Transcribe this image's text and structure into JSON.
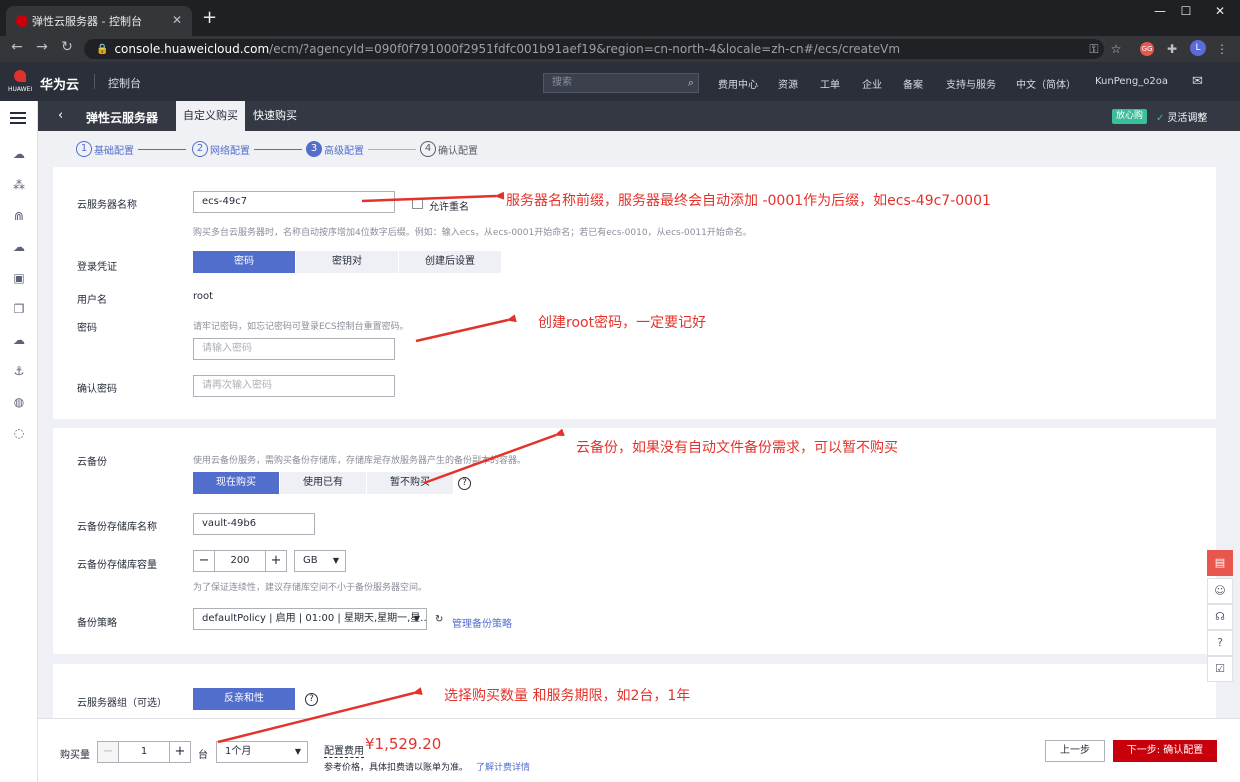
{
  "browser": {
    "tab_title": "弹性云服务器 - 控制台",
    "url_host": "console.huaweicloud.com",
    "url_path": "/ecm/?agencyId=090f0f791000f2951fdfc001b91aef19&region=cn-north-4&locale=zh-cn#/ecs/createVm",
    "profile_initial": "L",
    "ext_badge": "GG"
  },
  "topnav": {
    "brand": "华为云",
    "logo_word": "HUAWEI",
    "console": "控制台",
    "search_placeholder": "搜索",
    "items": [
      "费用中心",
      "资源",
      "工单",
      "企业",
      "备案",
      "支持与服务",
      "中文（简体）",
      "KunPeng_o2oa"
    ]
  },
  "header": {
    "title": "弹性云服务器",
    "tabs": [
      "自定义购买",
      "快速购买"
    ],
    "peace_badge": "放心购",
    "flex_adjust": "灵活调整"
  },
  "steps": [
    {
      "num": "1",
      "label": "基础配置"
    },
    {
      "num": "2",
      "label": "网络配置"
    },
    {
      "num": "3",
      "label": "高级配置"
    },
    {
      "num": "4",
      "label": "确认配置"
    }
  ],
  "name_section": {
    "label": "云服务器名称",
    "value": "ecs-49c7",
    "allow_dup": "允许重名",
    "hint": "购买多台云服务器时，名称自动按序增加4位数字后缀。例如：输入ecs，从ecs-0001开始命名；若已有ecs-0010，从ecs-0011开始命名。",
    "login_label": "登录凭证",
    "login_options": [
      "密码",
      "密钥对",
      "创建后设置"
    ],
    "username_label": "用户名",
    "username_value": "root",
    "password_label": "密码",
    "password_hint": "请牢记密码，如忘记密码可登录ECS控制台重置密码。",
    "password_placeholder": "请输入密码",
    "confirm_label": "确认密码",
    "confirm_placeholder": "请再次输入密码"
  },
  "backup_section": {
    "label": "云备份",
    "desc": "使用云备份服务，需购买备份存储库，存储库是存放服务器产生的备份副本的容器。",
    "options": [
      "现在购买",
      "使用已有",
      "暂不购买"
    ],
    "vault_label": "云备份存储库名称",
    "vault_value": "vault-49b6",
    "capacity_label": "云备份存储库容量",
    "capacity_value": "200",
    "capacity_unit": "GB",
    "capacity_hint": "为了保证连续性，建议存储库空间不小于备份服务器空间。",
    "policy_label": "备份策略",
    "policy_value": "defaultPolicy | 启用 | 01:00 | 星期天,星期一,星...",
    "policy_link": "管理备份策略"
  },
  "group_section": {
    "label": "云服务器组（可选）",
    "button": "反亲和性"
  },
  "bottom": {
    "qty_label": "购买量",
    "qty_value": "1",
    "qty_unit": "台",
    "duration": "1个月",
    "fee_label": "配置费用",
    "price": "¥1,529.20",
    "price_note": "参考价格，具体扣费请以账单为准。",
    "price_link": "了解计费详情",
    "prev": "上一步",
    "next": "下一步: 确认配置"
  },
  "annotations": {
    "a1": "服务器名称前缀，服务器最终会自动添加 -0001作为后缀，如ecs-49c7-0001",
    "a2": "创建root密码，一定要记好",
    "a3": "云备份，如果没有自动文件备份需求，可以暂不购买",
    "a4": "选择购买数量 和服务期限，如2台，1年"
  },
  "colors": {
    "accent": "#526ecc",
    "brand_red": "#c7000b",
    "annotation_red": "#e4322b"
  }
}
